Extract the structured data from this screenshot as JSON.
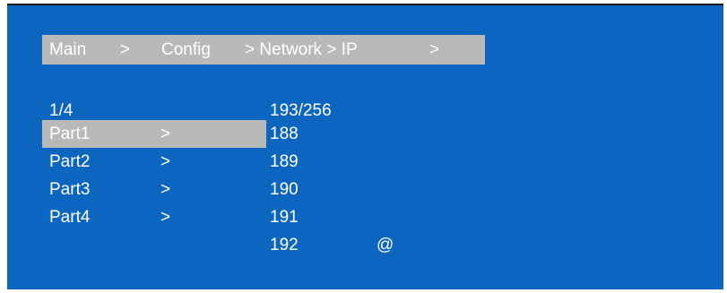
{
  "breadcrumb": {
    "main": "Main",
    "sep1": ">",
    "config": "Config",
    "sep2": "> Network > IP",
    "sep3": ">"
  },
  "left_column": {
    "page_indicator": "1/4",
    "items": [
      {
        "label": "Part1",
        "arrow": ">",
        "selected": true
      },
      {
        "label": "Part2",
        "arrow": ">",
        "selected": false
      },
      {
        "label": "Part3",
        "arrow": ">",
        "selected": false
      },
      {
        "label": "Part4",
        "arrow": ">",
        "selected": false
      }
    ]
  },
  "right_column": {
    "value_indicator": "193/256",
    "values": [
      "188",
      "189",
      "190",
      "191",
      "192"
    ],
    "marker": "@"
  },
  "colors": {
    "background": "#0c66bf",
    "highlight": "#b9b9b9",
    "text": "#ffffff"
  }
}
